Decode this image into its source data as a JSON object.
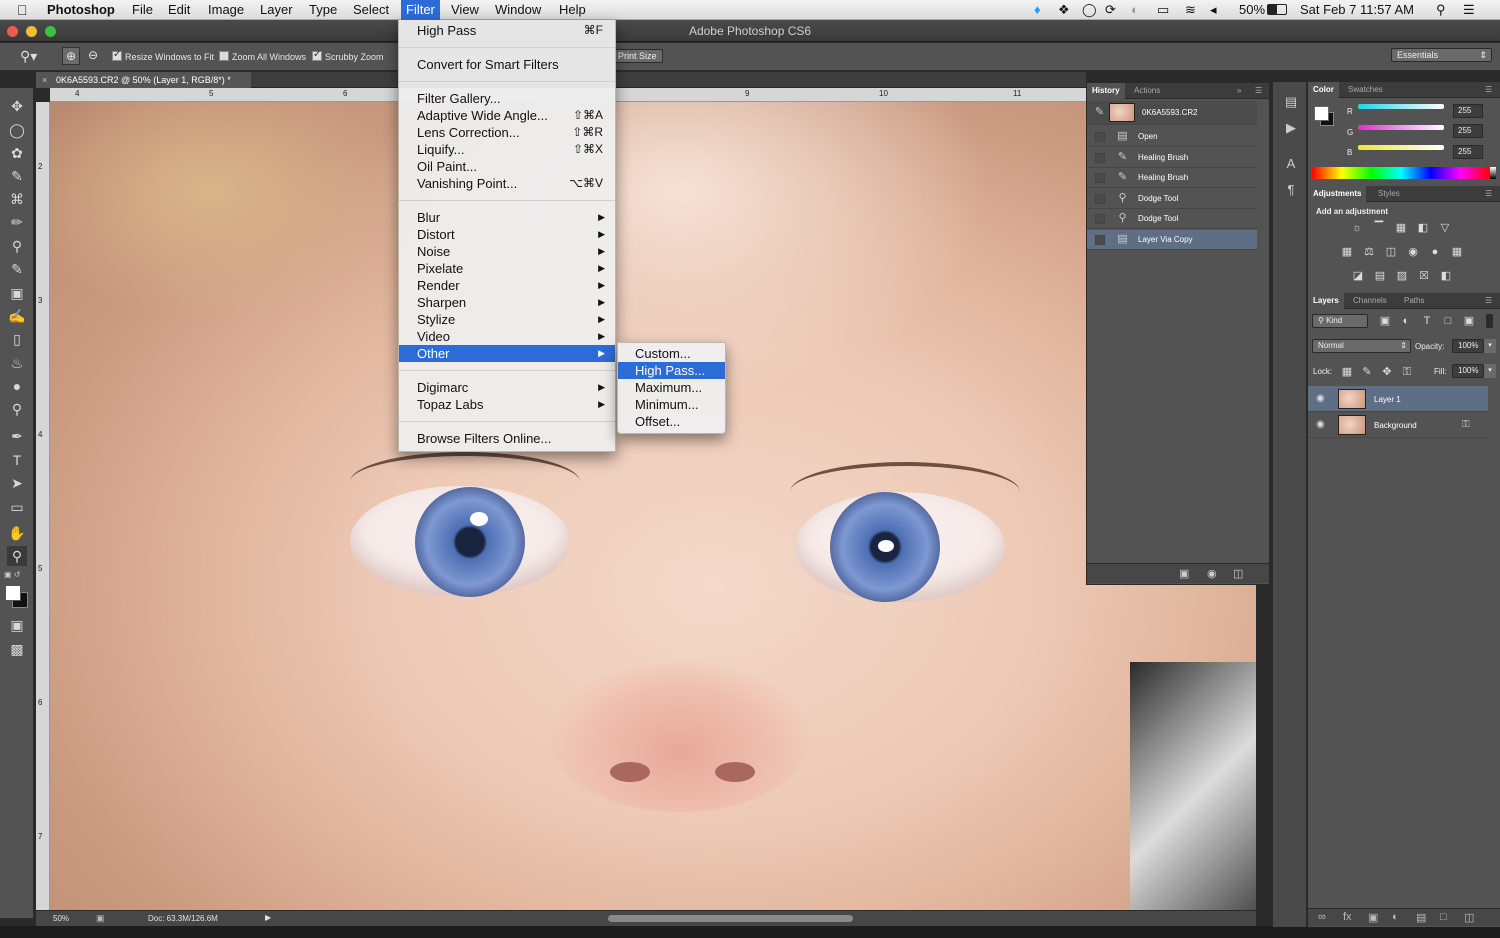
{
  "menubar": {
    "app_name": "Photoshop",
    "items": [
      "File",
      "Edit",
      "Image",
      "Layer",
      "Type",
      "Select",
      "Filter",
      "View",
      "Window",
      "Help"
    ],
    "active": "Filter",
    "battery": "50%",
    "clock": "Sat Feb 7  11:57 AM"
  },
  "window": {
    "title": "Adobe Photoshop CS6"
  },
  "options_bar": {
    "resize_windows": "Resize Windows to Fit",
    "zoom_all": "Zoom All Windows",
    "scrubby_zoom": "Scrubby Zoom",
    "print_size": "Print Size",
    "workspace": "Essentials"
  },
  "document": {
    "tab_label": "0K6A5593.CR2 @ 50% (Layer 1, RGB/8*) *",
    "ruler_h": [
      "4",
      "5",
      "6",
      "9",
      "10",
      "11"
    ],
    "ruler_v": [
      "2",
      "3",
      "4",
      "5",
      "6",
      "7"
    ],
    "zoom": "50%",
    "doc_size": "Doc: 63.3M/126.6M"
  },
  "filter_menu": {
    "last_filter": {
      "label": "High Pass",
      "shortcut": "⌘F"
    },
    "convert": "Convert for Smart Filters",
    "group1": [
      {
        "label": "Filter Gallery...",
        "shortcut": ""
      },
      {
        "label": "Adaptive Wide Angle...",
        "shortcut": "⇧⌘A"
      },
      {
        "label": "Lens Correction...",
        "shortcut": "⇧⌘R"
      },
      {
        "label": "Liquify...",
        "shortcut": "⇧⌘X"
      },
      {
        "label": "Oil Paint...",
        "shortcut": ""
      },
      {
        "label": "Vanishing Point...",
        "shortcut": "⌥⌘V"
      }
    ],
    "group2": [
      "Blur",
      "Distort",
      "Noise",
      "Pixelate",
      "Render",
      "Sharpen",
      "Stylize",
      "Video",
      "Other"
    ],
    "group3": [
      "Digimarc",
      "Topaz Labs"
    ],
    "browse": "Browse Filters Online...",
    "highlighted": "Other"
  },
  "other_submenu": {
    "items": [
      "Custom...",
      "High Pass...",
      "Maximum...",
      "Minimum...",
      "Offset..."
    ],
    "highlighted": "High Pass..."
  },
  "history_panel": {
    "tabs": [
      "History",
      "Actions"
    ],
    "snapshot": "0K6A5593.CR2",
    "steps": [
      "Open",
      "Healing Brush",
      "Healing Brush",
      "Dodge Tool",
      "Dodge Tool",
      "Layer Via Copy"
    ],
    "selected_step": "Layer Via Copy"
  },
  "color_panel": {
    "tabs": [
      "Color",
      "Swatches"
    ],
    "channels": [
      {
        "name": "R",
        "value": "255",
        "color": "#22d3e6"
      },
      {
        "name": "G",
        "value": "255",
        "color": "#e02ad8"
      },
      {
        "name": "B",
        "value": "255",
        "color": "#e8e82a"
      }
    ]
  },
  "adjustments_panel": {
    "tabs": [
      "Adjustments",
      "Styles"
    ],
    "heading": "Add an adjustment"
  },
  "layers_panel": {
    "tabs": [
      "Layers",
      "Channels",
      "Paths"
    ],
    "kind": "Kind",
    "blend_mode": "Normal",
    "opacity_label": "Opacity:",
    "opacity": "100%",
    "lock_label": "Lock:",
    "fill_label": "Fill:",
    "fill": "100%",
    "layers": [
      {
        "name": "Layer 1",
        "selected": true
      },
      {
        "name": "Background",
        "selected": false
      }
    ]
  },
  "colors": {
    "highlight": "#2d6bd6",
    "ui_gray": "#535353"
  }
}
